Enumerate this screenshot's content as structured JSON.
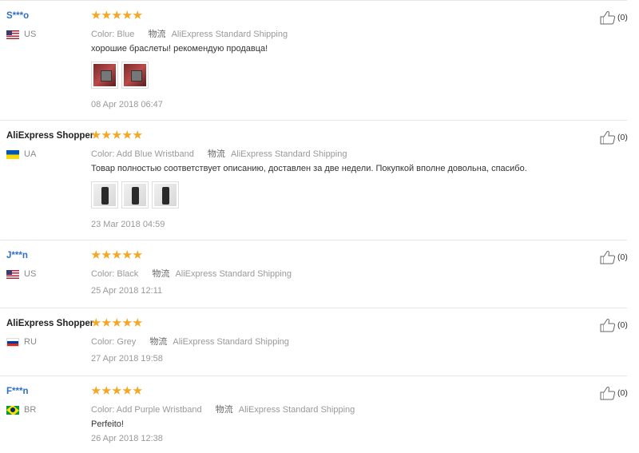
{
  "labels": {
    "color": "Color:",
    "shipping": "物流"
  },
  "reviews": [
    {
      "user": "S***o",
      "country": "US",
      "color": "Blue",
      "shipping": "AliExpress Standard Shipping",
      "comment": "хорошие браслеты! рекомендую продавца!",
      "photos": 2,
      "date": "08 Apr 2018 06:47",
      "helpful": "(0)",
      "rating": 5
    },
    {
      "user": "AliExpress Shopper",
      "country": "UA",
      "color": "Add Blue Wristband",
      "shipping": "AliExpress Standard Shipping",
      "comment": "Товар полностью соответствует описанию, доставлен за две недели. Покупкой вполне довольна, спасибо.",
      "photos": 3,
      "date": "23 Mar 2018 04:59",
      "helpful": "(0)",
      "rating": 5
    },
    {
      "user": "J***n",
      "country": "US",
      "color": "Black",
      "shipping": "AliExpress Standard Shipping",
      "comment": "",
      "photos": 0,
      "date": "25 Apr 2018 12:11",
      "helpful": "(0)",
      "rating": 5
    },
    {
      "user": "AliExpress Shopper",
      "country": "RU",
      "color": "Grey",
      "shipping": "AliExpress Standard Shipping",
      "comment": "",
      "photos": 0,
      "date": "27 Apr 2018 19:58",
      "helpful": "(0)",
      "rating": 5
    },
    {
      "user": "F***n",
      "country": "BR",
      "color": "Add Purple Wristband",
      "shipping": "AliExpress Standard Shipping",
      "comment": "Perfeito!",
      "photos": 0,
      "date": "26 Apr 2018 12:38",
      "helpful": "(0)",
      "rating": 5
    }
  ],
  "colors": {
    "star": "#f5a623",
    "masked_user": "#2f6fc7",
    "muted_text": "#999999",
    "divider": "#e6e6e6"
  },
  "icons": {
    "helpful": "thumbs-up-icon",
    "rating": "star-icon"
  }
}
